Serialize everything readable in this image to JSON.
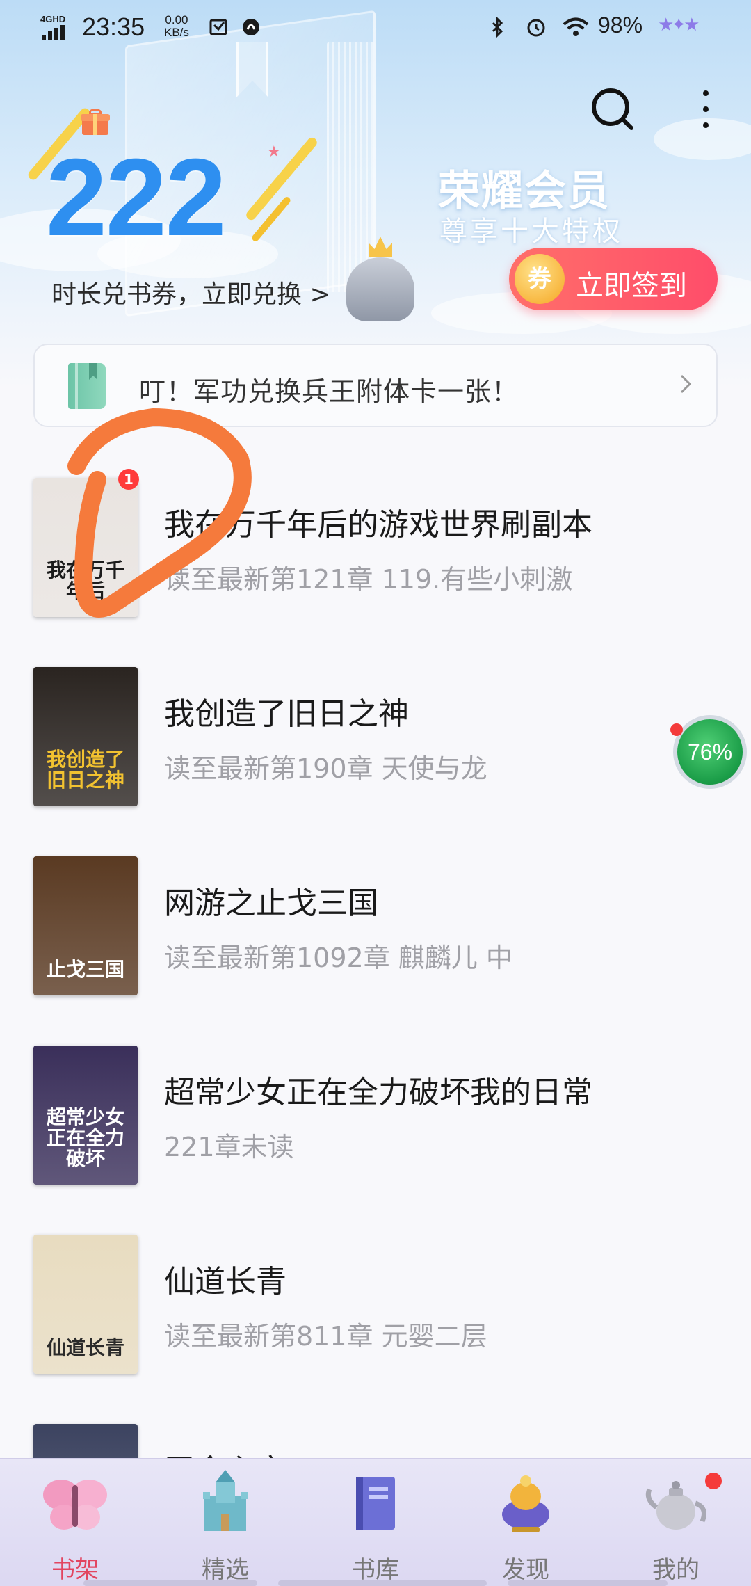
{
  "status_bar": {
    "network": "4GHD",
    "time": "23:35",
    "speed_value": "0.00",
    "speed_unit": "KB/s",
    "battery": "98%",
    "stars": "★✦★"
  },
  "header": {
    "count": "222",
    "count_label": "时长兑书券，立即兑换 >",
    "vip_title": "荣耀会员",
    "vip_subtitle": "尊享十大特权",
    "signin_coin": "券",
    "signin_label": "立即签到"
  },
  "notice": {
    "text": "叮！军功兑换兵王附体卡一张！"
  },
  "books": [
    {
      "title": "我在万千年后的游戏世界刷副本",
      "progress": "读至最新第121章 119.有些小刺激",
      "badge": "1",
      "cover_text": "我在万千年后",
      "cover_bg": "#e9e4e0",
      "cover_fg": "#1c1c1c"
    },
    {
      "title": "我创造了旧日之神",
      "progress": "读至最新第190章 天使与龙",
      "cover_text": "我创造了旧日之神",
      "cover_bg": "#2a2420",
      "cover_fg": "#f2c230"
    },
    {
      "title": "网游之止戈三国",
      "progress": "读至最新第1092章 麒麟儿 中",
      "cover_text": "止戈三国",
      "cover_bg": "#5a3a22",
      "cover_fg": "#ffffff"
    },
    {
      "title": "超常少女正在全力破坏我的日常",
      "progress": "221章未读",
      "cover_text": "超常少女正在全力破坏",
      "cover_bg": "#3a2f5a",
      "cover_fg": "#ffffff"
    },
    {
      "title": "仙道长青",
      "progress": "读至最新第811章 元婴二层",
      "cover_text": "仙道长青",
      "cover_bg": "#e8dcc0",
      "cover_fg": "#2a2a2a"
    },
    {
      "title": "王食主宰",
      "progress": "",
      "cover_text": "",
      "cover_bg": "#3c4360",
      "cover_fg": "#ffffff"
    }
  ],
  "floating_ball": {
    "value": "76%"
  },
  "bottom_nav": [
    {
      "label": "书架",
      "icon": "butterfly-icon",
      "active": true
    },
    {
      "label": "精选",
      "icon": "castle-icon",
      "active": false
    },
    {
      "label": "书库",
      "icon": "book-icon",
      "active": false
    },
    {
      "label": "发现",
      "icon": "lamp-icon",
      "active": false
    },
    {
      "label": "我的",
      "icon": "teapot-icon",
      "active": false
    }
  ],
  "colors": {
    "accent_blue": "#2e8ff0",
    "signin_red": "#ff4d6a",
    "nav_active": "#e24560",
    "annotation_orange": "#f57a3c"
  }
}
